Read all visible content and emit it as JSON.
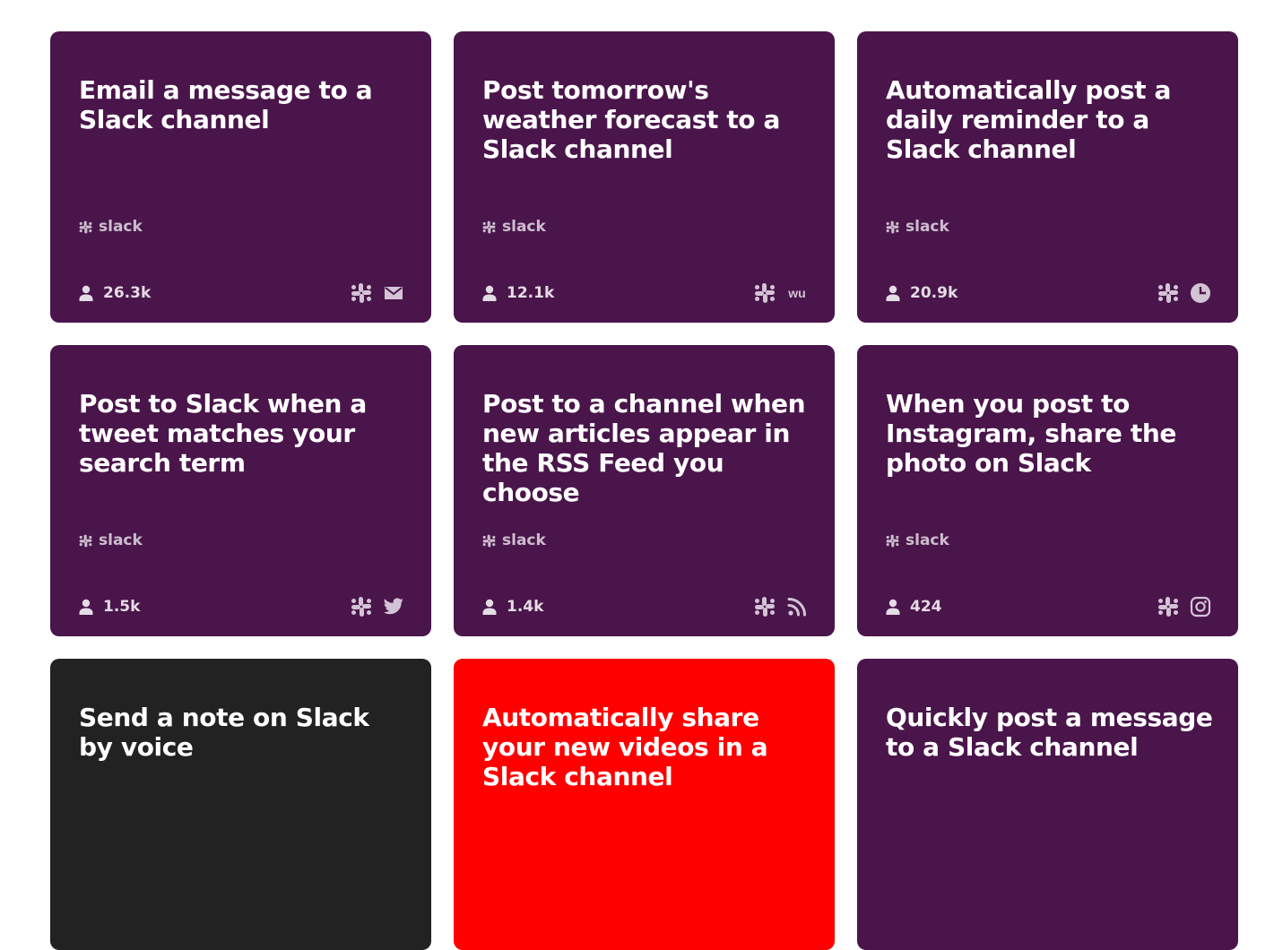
{
  "colors": {
    "slack_purple": "#4a154b",
    "dark": "#222222",
    "red": "#ff0000",
    "text": "#ffffff"
  },
  "cards": [
    {
      "title": "Email a message to a Slack channel",
      "service": "slack",
      "users": "26.3k",
      "color": "#4a154b",
      "icons": [
        "slack-icon",
        "email-icon"
      ]
    },
    {
      "title": "Post tomorrow's weather forecast to a Slack channel",
      "service": "slack",
      "users": "12.1k",
      "color": "#4a154b",
      "icons": [
        "slack-icon",
        "weather-underground-icon"
      ],
      "icon_text": "wu"
    },
    {
      "title": "Automatically post a daily reminder to a Slack channel",
      "service": "slack",
      "users": "20.9k",
      "color": "#4a154b",
      "icons": [
        "slack-icon",
        "clock-icon"
      ]
    },
    {
      "title": "Post to Slack when a tweet matches your search term",
      "service": "slack",
      "users": "1.5k",
      "color": "#4a154b",
      "icons": [
        "slack-icon",
        "twitter-icon"
      ]
    },
    {
      "title": "Post to a channel when new articles appear in the RSS Feed you choose",
      "service": "slack",
      "users": "1.4k",
      "color": "#4a154b",
      "icons": [
        "slack-icon",
        "rss-icon"
      ]
    },
    {
      "title": "When you post to Instagram, share the photo on Slack",
      "service": "slack",
      "users": "424",
      "color": "#4a154b",
      "icons": [
        "slack-icon",
        "instagram-icon"
      ]
    },
    {
      "title": "Send a note on Slack by voice",
      "color": "#222222"
    },
    {
      "title": "Automatically share your new videos in a Slack channel",
      "color": "#ff0000"
    },
    {
      "title": "Quickly post a message to a Slack channel",
      "color": "#4a154b"
    }
  ]
}
